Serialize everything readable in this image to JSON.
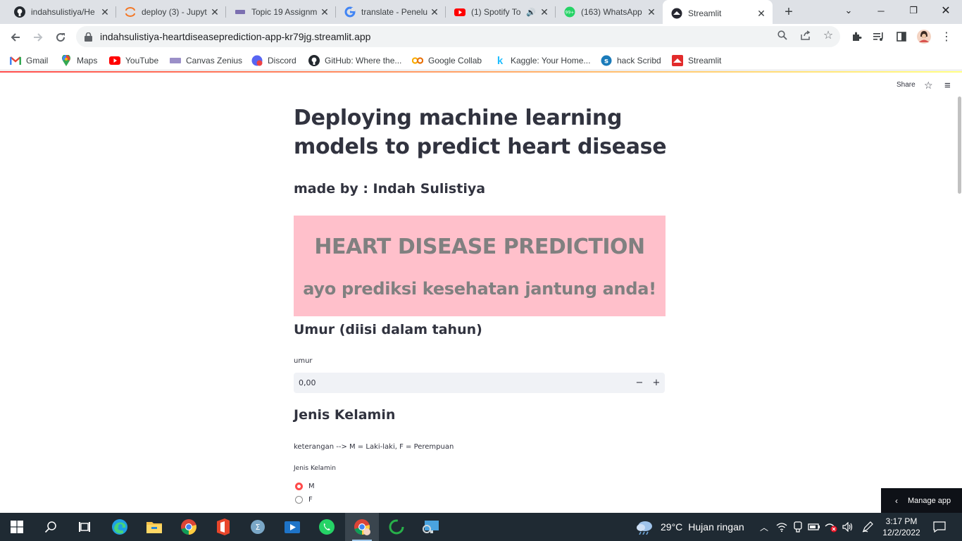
{
  "browser": {
    "tabs": [
      {
        "title": "indahsulistiya/He",
        "icon": "github-icon",
        "active": false
      },
      {
        "title": "deploy (3) - Jupyt",
        "icon": "jupyter-icon",
        "active": false
      },
      {
        "title": "Topic 19 Assignm",
        "icon": "zenius-icon",
        "active": false
      },
      {
        "title": "translate - Penelu",
        "icon": "google-icon",
        "active": false
      },
      {
        "title": "(1) Spotify To",
        "icon": "youtube-icon",
        "active": false
      },
      {
        "title": "(163) WhatsApp",
        "icon": "whatsapp-icon",
        "active": false
      },
      {
        "title": "Streamlit",
        "icon": "streamlit-icon",
        "active": true
      }
    ],
    "whatsapp_badge": "99+",
    "url": "indahsulistiya-heartdiseaseprediction-app-kr79jg.streamlit.app",
    "bookmarks": [
      {
        "label": "Gmail",
        "icon": "gmail-icon"
      },
      {
        "label": "Maps",
        "icon": "maps-icon"
      },
      {
        "label": "YouTube",
        "icon": "youtube-icon"
      },
      {
        "label": "Canvas Zenius",
        "icon": "zenius-icon"
      },
      {
        "label": "Discord",
        "icon": "discord-icon"
      },
      {
        "label": "GitHub: Where the...",
        "icon": "github-icon"
      },
      {
        "label": "Google Collab",
        "icon": "colab-icon"
      },
      {
        "label": "Kaggle: Your Home...",
        "icon": "kaggle-icon"
      },
      {
        "label": "hack Scribd",
        "icon": "scribd-icon"
      },
      {
        "label": "Streamlit",
        "icon": "streamlit-icon"
      }
    ]
  },
  "streamlit": {
    "toolbar": {
      "share_label": "Share"
    },
    "title": "Deploying machine learning models to predict heart disease",
    "made_by": "made by : Indah Sulistiya",
    "banner": {
      "heading": "HEART DISEASE PREDICTION",
      "subheading": "ayo prediksi kesehatan jantung anda!",
      "bg_color": "#ffc0cb",
      "text_color": "#808080"
    },
    "umur": {
      "heading": "Umur (diisi dalam tahun)",
      "label": "umur",
      "value": "0,00",
      "minus": "−",
      "plus": "+"
    },
    "jenis_kelamin": {
      "heading": "Jenis Kelamin",
      "note": "keterangan --> M = Laki-laki, F = Perempuan",
      "label": "Jenis Kelamin",
      "options": [
        {
          "label": "M",
          "selected": true
        },
        {
          "label": "F",
          "selected": false
        }
      ]
    },
    "manage_app": "Manage app",
    "accent_color": "#ff4b4b"
  },
  "taskbar": {
    "weather": {
      "temp": "29°C",
      "condition": "Hujan ringan"
    },
    "clock": {
      "time": "3:17 PM",
      "date": "12/2/2022"
    }
  }
}
